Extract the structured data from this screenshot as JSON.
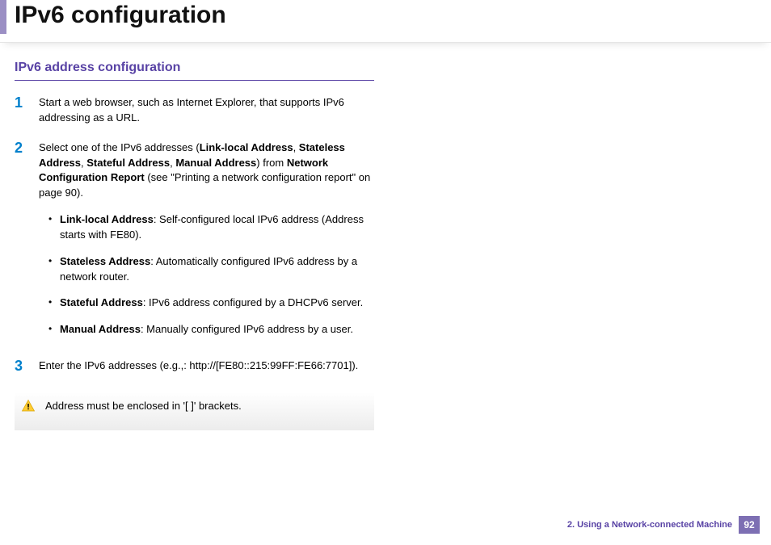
{
  "page_title": "IPv6 configuration",
  "section_title": "IPv6 address configuration",
  "steps": {
    "s1": {
      "num": "1",
      "text": "Start a web browser, such as Internet Explorer, that supports IPv6 addressing as a URL."
    },
    "s2": {
      "num": "2",
      "pre": "Select one of the IPv6 addresses (",
      "b1": "Link-local Address",
      "c1": ", ",
      "b2": "Stateless Address",
      "c2": ", ",
      "b3": "Stateful Address",
      "c3": ", ",
      "b4": "Manual Address",
      "c4": ") from ",
      "b5": "Network Configuration Report",
      "post": " (see \"Printing a network configuration report\" on page 90).",
      "bullets": {
        "i1": {
          "b": "Link-local Address",
          "t": ": Self-configured local IPv6 address (Address starts with FE80)."
        },
        "i2": {
          "b": "Stateless Address",
          "t": ": Automatically configured IPv6 address by a network router."
        },
        "i3": {
          "b": "Stateful Address",
          "t": ": IPv6 address configured by a DHCPv6 server."
        },
        "i4": {
          "b": "Manual Address",
          "t": ": Manually configured IPv6 address by a user."
        }
      }
    },
    "s3": {
      "num": "3",
      "text": "Enter the IPv6 addresses (e.g.,: http://[FE80::215:99FF:FE66:7701])."
    }
  },
  "note": "Address must be enclosed in '[ ]' brackets.",
  "footer": {
    "chapter": "2.  Using a Network-connected Machine",
    "page": "92"
  }
}
